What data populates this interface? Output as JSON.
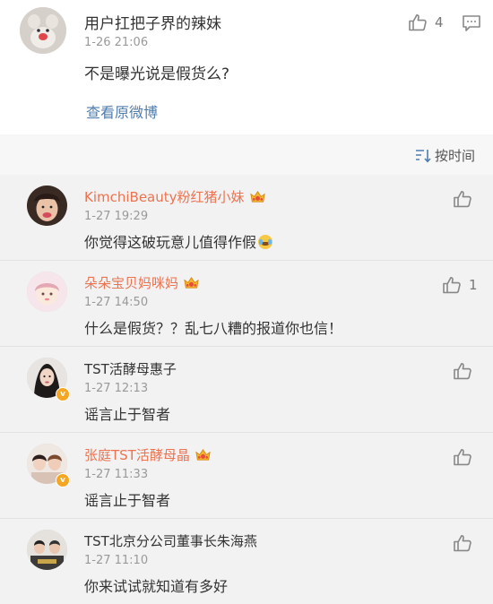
{
  "top_comment": {
    "username": "用户扛把子界的辣妹",
    "time": "1-26 21:06",
    "text": "不是曝光说是假货么?",
    "view_original": "查看原微博",
    "like_count": "4"
  },
  "sort": {
    "label": "按时间"
  },
  "comments": [
    {
      "username": "KimchiBeauty粉红猪小妹",
      "time": "1-27 19:29",
      "text": "你觉得这破玩意儿值得作假",
      "like_count": ""
    },
    {
      "username": "朵朵宝贝妈咪妈",
      "time": "1-27 14:50",
      "text": "什么是假货？？乱七八糟的报道你也信！",
      "like_count": "1"
    },
    {
      "username": "TST活酵母惠子",
      "time": "1-27 12:13",
      "text": "谣言止于智者",
      "like_count": ""
    },
    {
      "username": "张庭TST活酵母晶",
      "time": "1-27 11:33",
      "text": "谣言止于智者",
      "like_count": ""
    },
    {
      "username": "TST北京分公司董事长朱海燕",
      "time": "1-27 11:10",
      "text": "你来试试就知道有多好",
      "like_count": ""
    }
  ],
  "colors": {
    "vip_name": "#eb7350",
    "link": "#507daf",
    "meta": "#999999",
    "badge": "#f5a623"
  },
  "icons": [
    "thumbs-up-icon",
    "comment-icon",
    "sort-icon",
    "crown-vip-icon",
    "verified-v-icon",
    "laughing-tears-emoji-icon"
  ]
}
